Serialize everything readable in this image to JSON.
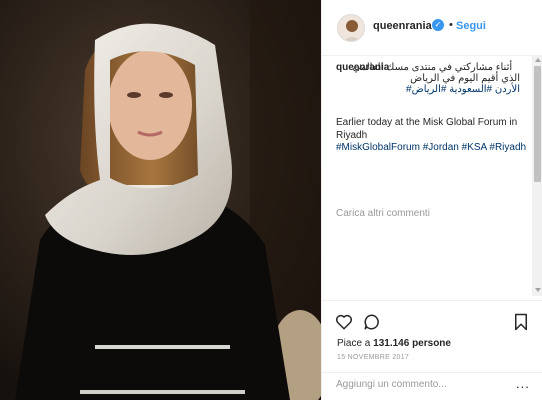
{
  "post": {
    "username": "queenrania",
    "verified_badge": "✓",
    "separator": "•",
    "follow_label": "Segui",
    "caption": {
      "user": "queenrania",
      "arabic_line1": "أثناء مشاركتي في منتدى مسك العالمي",
      "arabic_line2": "الذي أقيم اليوم في الرياض",
      "arabic_hashtags": "الأردن #السعودية #الرياض#",
      "english_text": "Earlier today at the Misk Global Forum in Riyadh",
      "english_hashtags": "#MiskGlobalForum #Jordan #KSA #Riyadh"
    },
    "load_more_label": "Carica altri commenti",
    "likes_prefix": "Piace a ",
    "likes_count": "131.146 persone",
    "date": "15 NOVEMBRE 2017",
    "add_comment_placeholder": "Aggiungi un commento...",
    "more_options": "...",
    "icons": {
      "like": "heart-outline-icon",
      "comment": "speech-bubble-icon",
      "save": "bookmark-icon",
      "verified": "verified-badge-icon"
    },
    "colors": {
      "link": "#003569",
      "follow": "#3897f0",
      "muted": "#999999",
      "border": "#efefef"
    }
  }
}
